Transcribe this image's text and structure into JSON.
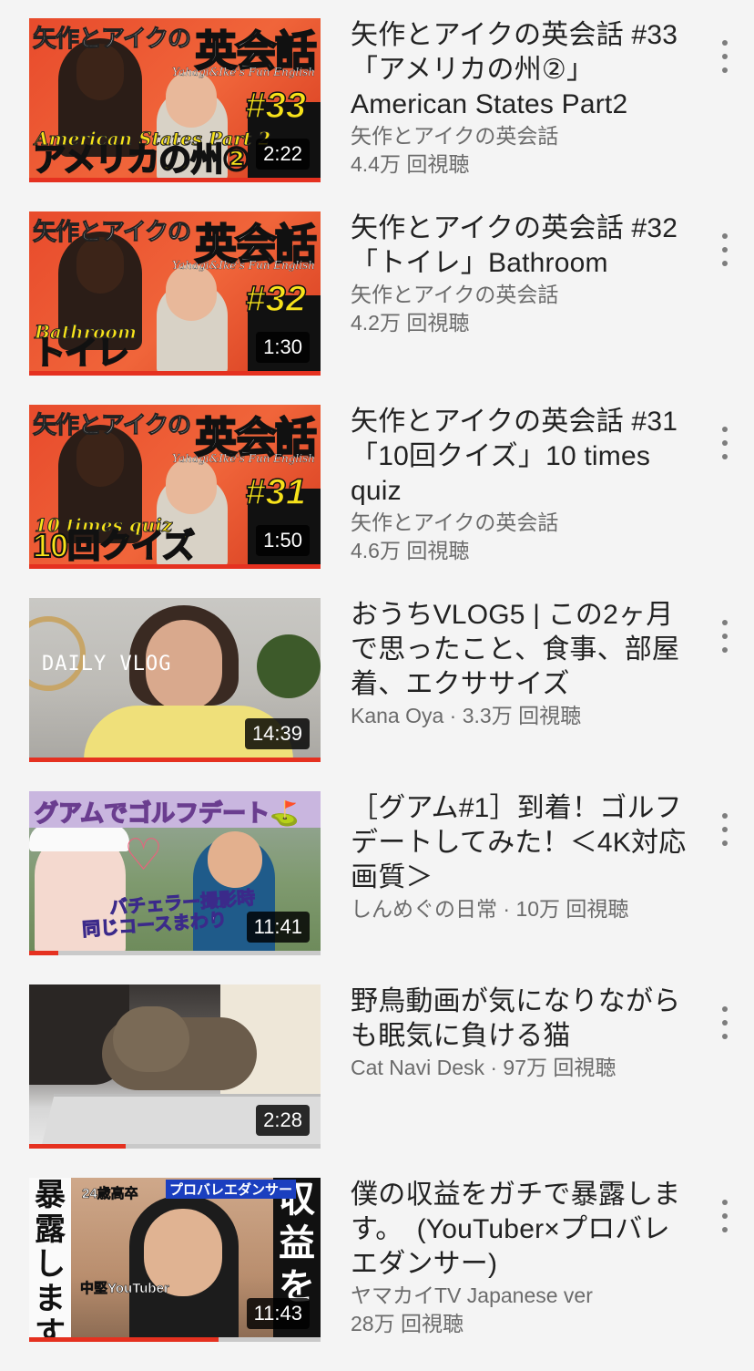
{
  "videos": [
    {
      "title": "矢作とアイクの英会話 #33「アメリカの州②」American States Part2",
      "meta": "矢作とアイクの英会話",
      "views": "4.4万 回視聴",
      "duration": "2:22",
      "progress": 1.0,
      "thumb": {
        "header": "矢作とアイクの",
        "big": "英会話",
        "sub": "Yahagi&Ike's Fun English",
        "number": "#33",
        "caption_en": "American States Part 2",
        "caption_jp": "アメリカの州②"
      }
    },
    {
      "title": "矢作とアイクの英会話 #32「トイレ」Bathroom",
      "meta": "矢作とアイクの英会話",
      "views": "4.2万 回視聴",
      "duration": "1:30",
      "progress": 1.0,
      "thumb": {
        "header": "矢作とアイクの",
        "big": "英会話",
        "sub": "Yahagi&Ike's Fun English",
        "number": "#32",
        "caption_en": "Bathroom",
        "caption_jp": "トイレ"
      }
    },
    {
      "title": "矢作とアイクの英会話 #31「10回クイズ」10 times quiz",
      "meta": "矢作とアイクの英会話",
      "views": "4.6万 回視聴",
      "duration": "1:50",
      "progress": 1.0,
      "thumb": {
        "header": "矢作とアイクの",
        "big": "英会話",
        "sub": "Yahagi&Ike's Fun English",
        "number": "#31",
        "caption_en": "10 times quiz",
        "caption_jp": "10回クイズ"
      }
    },
    {
      "title": "おうちVLOG5 | この2ヶ月で思ったこと、食事、部屋着、エクササイズ",
      "meta": "Kana Oya · 3.3万 回視聴",
      "duration": "14:39",
      "progress": 1.0,
      "thumb": {
        "label": "DAILY VLOG"
      }
    },
    {
      "title": "［グアム#1］到着！ゴルフデートしてみた！＜4K対応画質＞",
      "meta": "しんめぐの日常 · 10万 回視聴",
      "duration": "11:41",
      "progress": 0.1,
      "thumb": {
        "band": "グアムでゴルフデート⛳",
        "line1": "バチェラー撮影時",
        "line2": "同じコースまわり"
      }
    },
    {
      "title": "野鳥動画が気になりながらも眠気に負ける猫",
      "meta": "Cat Navi Desk · 97万 回視聴",
      "duration": "2:28",
      "progress": 0.33,
      "thumb": {}
    },
    {
      "title": "僕の収益をガチで暴露します。　(YouTuber×プロバレエダンサー)",
      "meta": "ヤマカイTV Japanese ver",
      "views": "28万 回視聴",
      "duration": "11:43",
      "progress": 0.65,
      "thumb": {
        "left_text": "暴露します",
        "right_text": "収益を",
        "note1": "24歳高卒",
        "note2": "プロバレエダンサー",
        "note3": "中堅YouTuber"
      }
    }
  ]
}
